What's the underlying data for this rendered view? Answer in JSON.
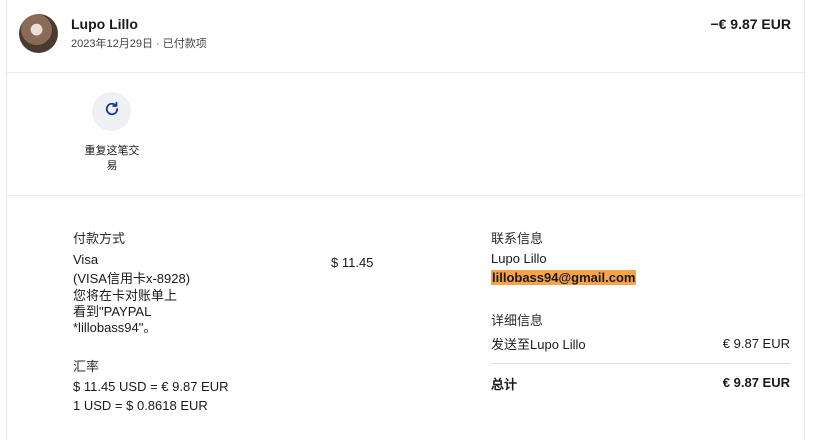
{
  "header": {
    "name": "Lupo Lillo",
    "subtitle": "2023年12月29日 · 已付款项",
    "amount": "−€ 9.87 EUR"
  },
  "action": {
    "repeat_label": "重复这笔交易",
    "icon": "refresh-icon"
  },
  "payment": {
    "heading": "付款方式",
    "method": "Visa",
    "card": "(VISA信用卡x-8928)",
    "note_line1": "您将在卡对账单上",
    "note_line2": "看到\"PAYPAL",
    "note_line3": "*lillobass94\"。",
    "charged": "$ 11.45"
  },
  "exchange": {
    "heading": "汇率",
    "line1": "$ 11.45 USD = € 9.87 EUR",
    "line2": "1 USD = $ 0.8618 EUR"
  },
  "contact": {
    "heading": "联系信息",
    "name": "Lupo Lillo",
    "email": "lillobass94@gmail.com"
  },
  "details": {
    "heading": "详细信息",
    "sent_to": "发送至Lupo Lillo",
    "sent_amount": "€ 9.87 EUR",
    "total_label": "总计",
    "total_amount": "€ 9.87 EUR"
  },
  "colors": {
    "highlight": "#f5a24b",
    "icon_blue": "#1b3a8a"
  }
}
